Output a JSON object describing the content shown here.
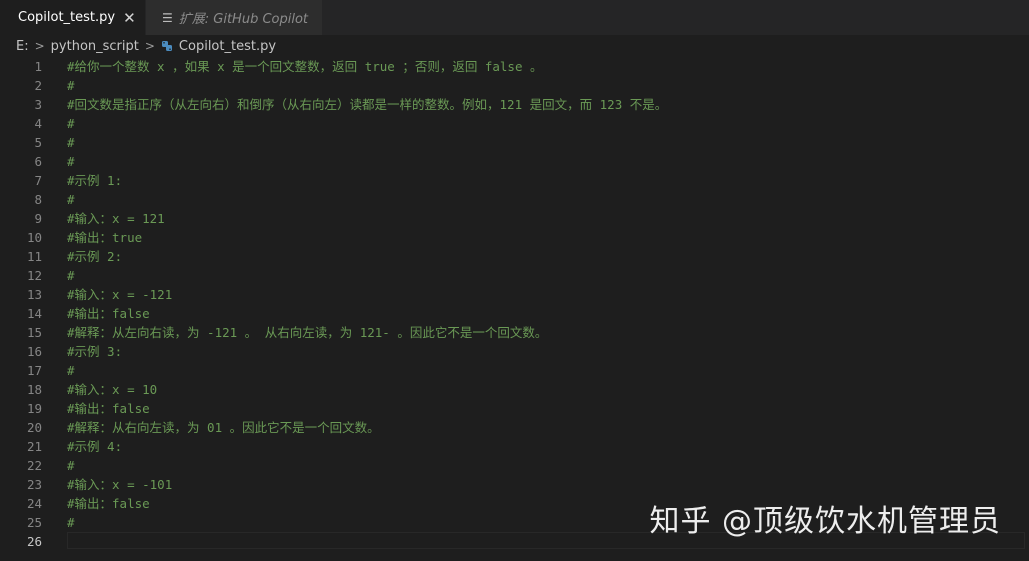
{
  "tabs": [
    {
      "label": "Copilot_test.py",
      "close": "✕"
    },
    {
      "label": "扩展: GitHub Copilot",
      "icon": "preview-icon"
    }
  ],
  "breadcrumb": {
    "drive": "E:",
    "folder": "python_script",
    "file": "Copilot_test.py"
  },
  "colors": {
    "comment": "#6a9955",
    "python_icon": "#4b8bbe",
    "background": "#1e1e1e"
  },
  "lines": [
    {
      "n": "1",
      "text": "#给你一个整数 x ，如果 x 是一个回文整数，返回 true ；否则，返回 false 。"
    },
    {
      "n": "2",
      "text": "#"
    },
    {
      "n": "3",
      "text": "#回文数是指正序（从左向右）和倒序（从右向左）读都是一样的整数。例如，121 是回文，而 123 不是。"
    },
    {
      "n": "4",
      "text": "#"
    },
    {
      "n": "5",
      "text": "#"
    },
    {
      "n": "6",
      "text": "#"
    },
    {
      "n": "7",
      "text": "#示例 1:"
    },
    {
      "n": "8",
      "text": "#"
    },
    {
      "n": "9",
      "text": "#输入：x = 121"
    },
    {
      "n": "10",
      "text": "#输出：true"
    },
    {
      "n": "11",
      "text": "#示例 2:"
    },
    {
      "n": "12",
      "text": "#"
    },
    {
      "n": "13",
      "text": "#输入：x = -121"
    },
    {
      "n": "14",
      "text": "#输出：false"
    },
    {
      "n": "15",
      "text": "#解释：从左向右读，为 -121 。 从右向左读，为 121- 。因此它不是一个回文数。"
    },
    {
      "n": "16",
      "text": "#示例 3:"
    },
    {
      "n": "17",
      "text": "#"
    },
    {
      "n": "18",
      "text": "#输入：x = 10"
    },
    {
      "n": "19",
      "text": "#输出：false"
    },
    {
      "n": "20",
      "text": "#解释：从右向左读，为 01 。因此它不是一个回文数。"
    },
    {
      "n": "21",
      "text": "#示例 4:"
    },
    {
      "n": "22",
      "text": "#"
    },
    {
      "n": "23",
      "text": "#输入：x = -101"
    },
    {
      "n": "24",
      "text": "#输出：false"
    },
    {
      "n": "25",
      "text": "#"
    },
    {
      "n": "26",
      "text": ""
    }
  ],
  "watermark": "知乎 @顶级饮水机管理员"
}
